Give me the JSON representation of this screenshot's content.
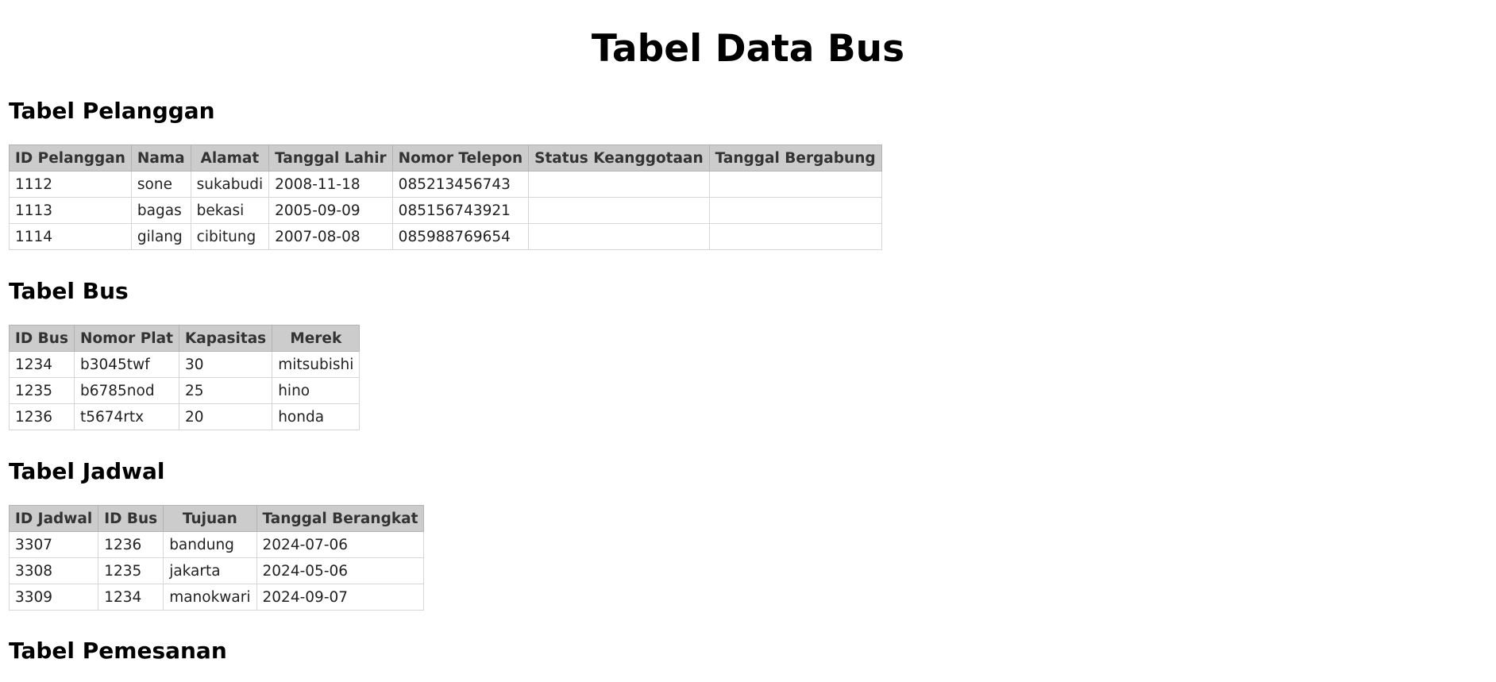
{
  "page_title": "Tabel Data Bus",
  "pelanggan": {
    "title": "Tabel Pelanggan",
    "headers": [
      "ID Pelanggan",
      "Nama",
      "Alamat",
      "Tanggal Lahir",
      "Nomor Telepon",
      "Status Keanggotaan",
      "Tanggal Bergabung"
    ],
    "rows": [
      [
        "1112",
        "sone",
        "sukabudi",
        "2008-11-18",
        "085213456743",
        "",
        ""
      ],
      [
        "1113",
        "bagas",
        "bekasi",
        "2005-09-09",
        "085156743921",
        "",
        ""
      ],
      [
        "1114",
        "gilang",
        "cibitung",
        "2007-08-08",
        "085988769654",
        "",
        ""
      ]
    ]
  },
  "bus": {
    "title": "Tabel Bus",
    "headers": [
      "ID Bus",
      "Nomor Plat",
      "Kapasitas",
      "Merek"
    ],
    "rows": [
      [
        "1234",
        "b3045twf",
        "30",
        "mitsubishi"
      ],
      [
        "1235",
        "b6785nod",
        "25",
        "hino"
      ],
      [
        "1236",
        "t5674rtx",
        "20",
        "honda"
      ]
    ]
  },
  "jadwal": {
    "title": "Tabel Jadwal",
    "headers": [
      "ID Jadwal",
      "ID Bus",
      "Tujuan",
      "Tanggal Berangkat"
    ],
    "rows": [
      [
        "3307",
        "1236",
        "bandung",
        "2024-07-06"
      ],
      [
        "3308",
        "1235",
        "jakarta",
        "2024-05-06"
      ],
      [
        "3309",
        "1234",
        "manokwari",
        "2024-09-07"
      ]
    ]
  },
  "pemesanan": {
    "title": "Tabel Pemesanan"
  }
}
